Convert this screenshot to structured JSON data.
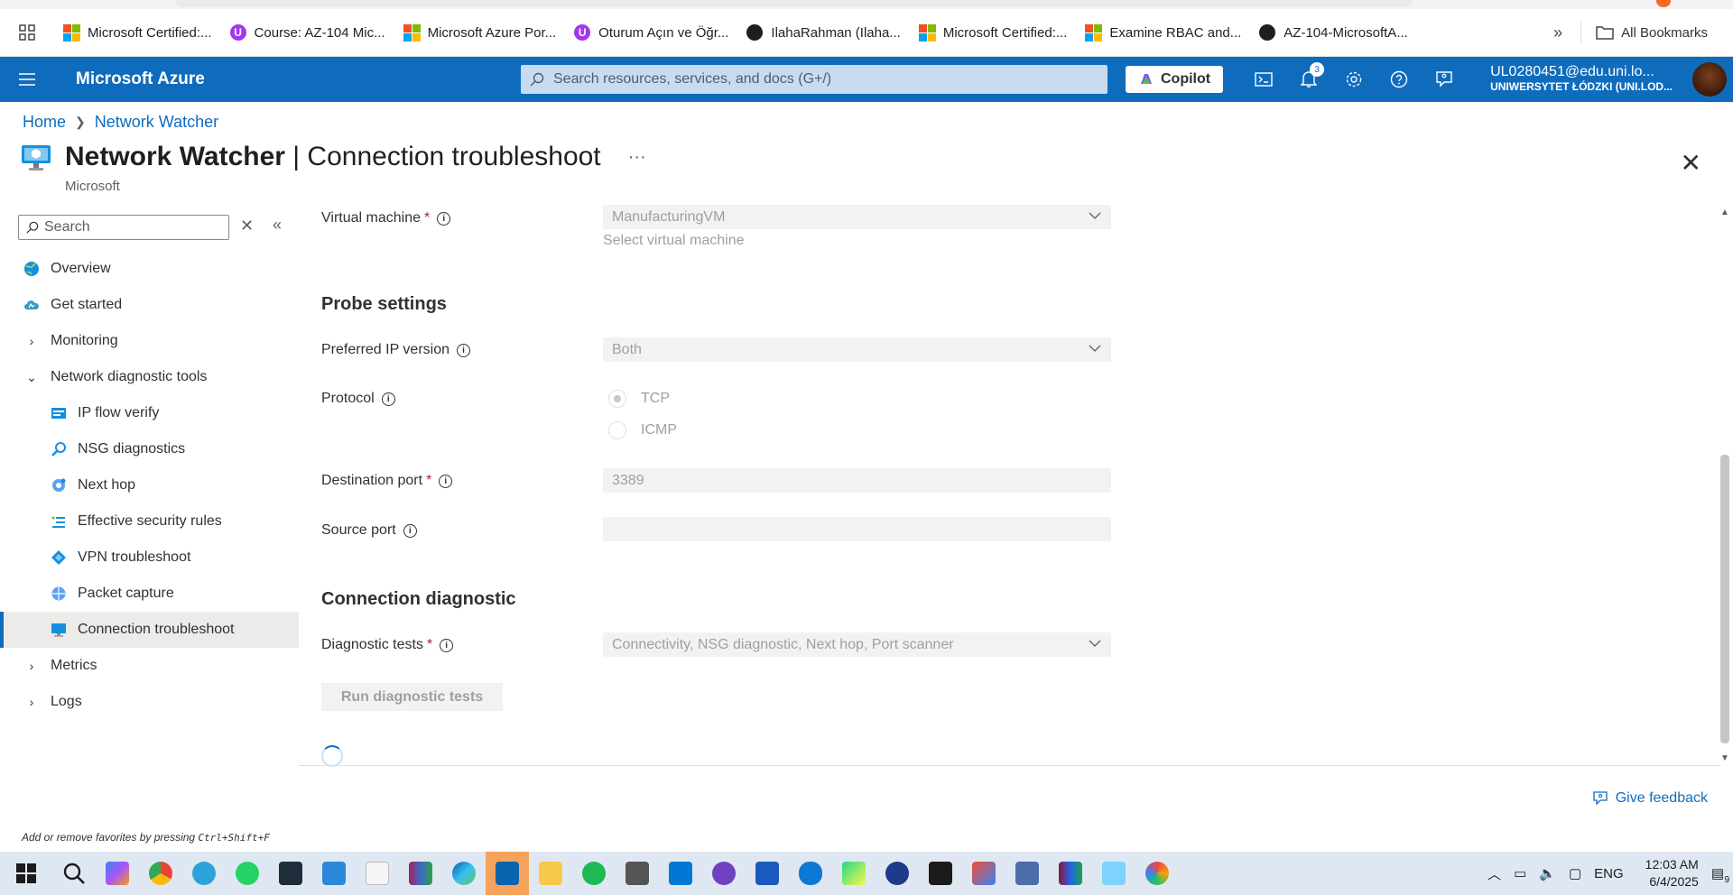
{
  "bookmarks": {
    "items": [
      {
        "label": "Microsoft Certified:...",
        "icon": "microsoft-logo"
      },
      {
        "label": "Course: AZ-104 Mic...",
        "icon": "udemy-icon"
      },
      {
        "label": "Microsoft Azure Por...",
        "icon": "microsoft-logo"
      },
      {
        "label": "Oturum Açın ve Öğr...",
        "icon": "udemy-icon"
      },
      {
        "label": "IlahaRahman (Ilaha...",
        "icon": "github-icon"
      },
      {
        "label": "Microsoft Certified:...",
        "icon": "microsoft-logo"
      },
      {
        "label": "Examine RBAC and...",
        "icon": "microsoft-logo"
      },
      {
        "label": "AZ-104-MicrosoftA...",
        "icon": "github-icon"
      }
    ],
    "more": "»",
    "all_bookmarks": "All Bookmarks"
  },
  "header": {
    "brand": "Microsoft Azure",
    "search_placeholder": "Search resources, services, and docs (G+/)",
    "copilot": "Copilot",
    "notifications_count": "3",
    "account_email": "UL0280451@edu.uni.lo...",
    "account_org": "UNIWERSYTET ŁÓDZKI (UNI.LOD..."
  },
  "breadcrumb": {
    "home": "Home",
    "current": "Network Watcher"
  },
  "page": {
    "title_main": "Network Watcher",
    "title_sep": " | ",
    "title_sub": "Connection troubleshoot",
    "more": "···",
    "subtitle": "Microsoft",
    "close": "✕"
  },
  "sidebar": {
    "search_placeholder": "Search",
    "items": [
      {
        "label": "Overview",
        "level": 0,
        "chevron": "",
        "icon": "globe-icon"
      },
      {
        "label": "Get started",
        "level": 0,
        "chevron": "",
        "icon": "cloud-icon"
      },
      {
        "label": "Monitoring",
        "level": 0,
        "chevron": "›",
        "icon": ""
      },
      {
        "label": "Network diagnostic tools",
        "level": 0,
        "chevron": "⌄",
        "icon": ""
      },
      {
        "label": "IP flow verify",
        "level": 1,
        "icon": "ip-flow-icon"
      },
      {
        "label": "NSG diagnostics",
        "level": 1,
        "icon": "nsg-icon"
      },
      {
        "label": "Next hop",
        "level": 1,
        "icon": "next-hop-icon"
      },
      {
        "label": "Effective security rules",
        "level": 1,
        "icon": "security-rules-icon"
      },
      {
        "label": "VPN troubleshoot",
        "level": 1,
        "icon": "vpn-icon"
      },
      {
        "label": "Packet capture",
        "level": 1,
        "icon": "packet-capture-icon"
      },
      {
        "label": "Connection troubleshoot",
        "level": 1,
        "icon": "monitor-icon",
        "active": true
      },
      {
        "label": "Metrics",
        "level": 0,
        "chevron": "›",
        "icon": ""
      },
      {
        "label": "Logs",
        "level": 0,
        "chevron": "›",
        "icon": ""
      }
    ]
  },
  "form": {
    "vm_label": "Virtual machine",
    "vm_value": "ManufacturingVM",
    "vm_hint": "Select virtual machine",
    "probe_heading": "Probe settings",
    "ip_version_label": "Preferred IP version",
    "ip_version_value": "Both",
    "protocol_label": "Protocol",
    "protocol_tcp": "TCP",
    "protocol_icmp": "ICMP",
    "dest_port_label": "Destination port",
    "dest_port_value": "3389",
    "source_port_label": "Source port",
    "source_port_value": "",
    "diag_heading": "Connection diagnostic",
    "diag_tests_label": "Diagnostic tests",
    "diag_tests_value": "Connectivity, NSG diagnostic, Next hop, Port scanner",
    "run_button": "Run diagnostic tests",
    "required_mark": "*",
    "info_glyph": "i"
  },
  "footer": {
    "feedback": "Give feedback",
    "fav_hint_prefix": "Add or remove favorites by pressing ",
    "fav_hint_keys": "Ctrl+Shift+F"
  },
  "taskbar": {
    "lang": "ENG",
    "time": "12:03 AM",
    "date": "6/4/2025",
    "notif_count": "9"
  },
  "colors": {
    "azure_blue": "#0f6cbd",
    "taskbar_bg": "#dfe8f2"
  }
}
